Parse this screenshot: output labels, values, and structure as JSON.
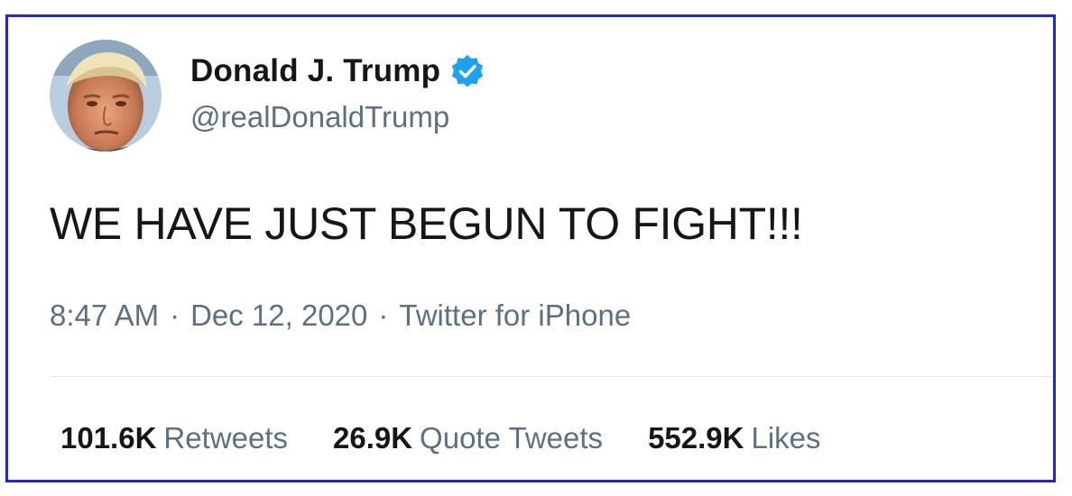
{
  "tweet": {
    "author": {
      "display_name": "Donald J. Trump",
      "handle": "@realDonaldTrump",
      "verified": true
    },
    "text": "WE HAVE JUST BEGUN TO FIGHT!!!",
    "meta": {
      "time": "8:47 AM",
      "separator": "·",
      "date": "Dec 12, 2020",
      "source": "Twitter for iPhone"
    },
    "stats": [
      {
        "value": "101.6K",
        "label": "Retweets"
      },
      {
        "value": "26.9K",
        "label": "Quote Tweets"
      },
      {
        "value": "552.9K",
        "label": "Likes"
      }
    ]
  },
  "colors": {
    "border": "#2027d8",
    "verified_badge": "#1da1f2",
    "primary_text": "#14171a",
    "secondary_text": "#5b7083",
    "divider": "#e1e8ed"
  },
  "icons": {
    "verified": "verified-badge-icon",
    "avatar": "profile-photo"
  }
}
